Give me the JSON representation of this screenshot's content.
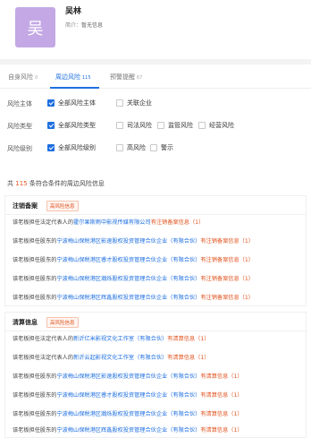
{
  "header": {
    "avatar_char": "吴",
    "name": "吴林",
    "intro_label": "简介：",
    "intro_value": "暂无信息"
  },
  "tabs": [
    {
      "label": "自身风险",
      "count": "0",
      "active": false
    },
    {
      "label": "周边风险",
      "count": "115",
      "active": true
    },
    {
      "label": "预警提醒",
      "count": "67",
      "active": false
    }
  ],
  "filters": {
    "subject": {
      "label": "风险主体",
      "options": [
        {
          "label": "全部风险主体",
          "checked": true
        },
        {
          "label": "关联企业",
          "checked": false
        }
      ]
    },
    "type": {
      "label": "风险类型",
      "options": [
        {
          "label": "全部风险类型",
          "checked": true
        },
        {
          "label": "司法风险",
          "checked": false
        },
        {
          "label": "监管风险",
          "checked": false
        },
        {
          "label": "经营风险",
          "checked": false
        }
      ]
    },
    "level": {
      "label": "风险级别",
      "options": [
        {
          "label": "全部风险级别",
          "checked": true
        },
        {
          "label": "高风险",
          "checked": false
        },
        {
          "label": "警示",
          "checked": false
        }
      ]
    }
  },
  "summary": {
    "prefix": "共",
    "count": "115",
    "suffix": "条符合条件的周边风险信息"
  },
  "sections": [
    {
      "title": "注销备案",
      "badge": "高风险信息",
      "items": [
        {
          "pre": "该老板担任法定代表人的",
          "company": "霍尔果斯雨中影视传媒有限公司",
          "status": "有注销备案信息（1）"
        },
        {
          "pre": "该老板担任股东的",
          "company": "宁波梅山保税港区影速股权投资管理合伙企业（有限合伙）",
          "status": "有注销备案信息（1）"
        },
        {
          "pre": "该老板担任股东的",
          "company": "宁波梅山保税港区睿才股权投资管理合伙企业（有限合伙）",
          "status": "有注销备案信息（1）"
        },
        {
          "pre": "该老板担任股东的",
          "company": "宁波梅山保税港区瀚烁股权投资管理合伙企业（有限合伙）",
          "status": "有注销备案信息（1）"
        },
        {
          "pre": "该老板担任股东的",
          "company": "宁波梅山保税港区辉鑫股权投资管理合伙企业（有限合伙）",
          "status": "有注销备案信息（1）"
        }
      ]
    },
    {
      "title": "清算信息",
      "badge": "高风险信息",
      "items": [
        {
          "pre": "该老板担任法定代表人的",
          "company": "新沂亿米影视文化工作室（有限合伙）",
          "status": "有清算信息（1）"
        },
        {
          "pre": "该老板担任法定代表人的",
          "company": "新沂云起影视文化工作室（有限合伙）",
          "status": "有清算信息（1）"
        },
        {
          "pre": "该老板担任股东的",
          "company": "宁波梅山保税港区影速股权投资管理合伙企业（有限合伙）",
          "status": "有清算信息（1）"
        },
        {
          "pre": "该老板担任股东的",
          "company": "宁波梅山保税港区睿才股权投资管理合伙企业（有限合伙）",
          "status": "有清算信息（1）"
        },
        {
          "pre": "该老板担任股东的",
          "company": "宁波梅山保税港区瀚烁股权投资管理合伙企业（有限合伙）",
          "status": "有清算信息（1）"
        },
        {
          "pre": "该老板担任股东的",
          "company": "宁波梅山保税港区辉鑫股权投资管理合伙企业（有限合伙）",
          "status": "有清算信息（1）"
        }
      ]
    }
  ],
  "colors": {
    "accent": "#1e6fe0",
    "risk": "#e0531f",
    "avatar": "#c3a8e5"
  }
}
